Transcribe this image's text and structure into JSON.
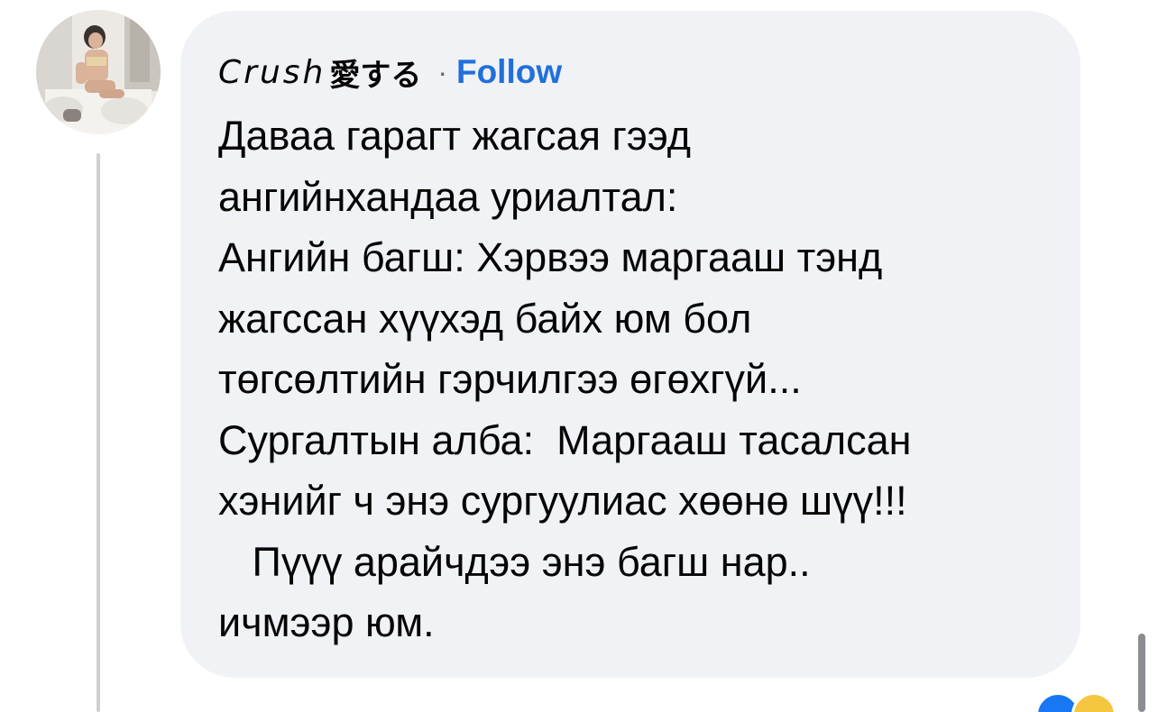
{
  "comment": {
    "author_name": "Crush",
    "author_suffix": "愛する",
    "separator": "·",
    "follow_label": "Follow",
    "lines": [
      "Даваа гарагт жагсая гээд",
      "ангийнхандаа уриалтал:",
      "Ангийн багш: Хэрвээ маргааш тэнд",
      "жагссан хүүхэд байх юм бол",
      "төгсөлтийн гэрчилгээ өгөхгүй...",
      "Сургалтын алба:  Маргааш тасалсан",
      "хэнийг ч энэ сургуулиас хөөнө шүү!!!",
      "   Пүүү арайчдээ энэ багш нар..",
      "ичмээр юм."
    ]
  },
  "colors": {
    "bubble": "#f0f2f5",
    "text": "#050505",
    "follow": "#216fdb",
    "thread_line": "#ced0d4"
  },
  "icons": {
    "avatar": "profile-photo",
    "reactions": [
      "like-reaction-icon",
      "haha-reaction-icon"
    ]
  }
}
